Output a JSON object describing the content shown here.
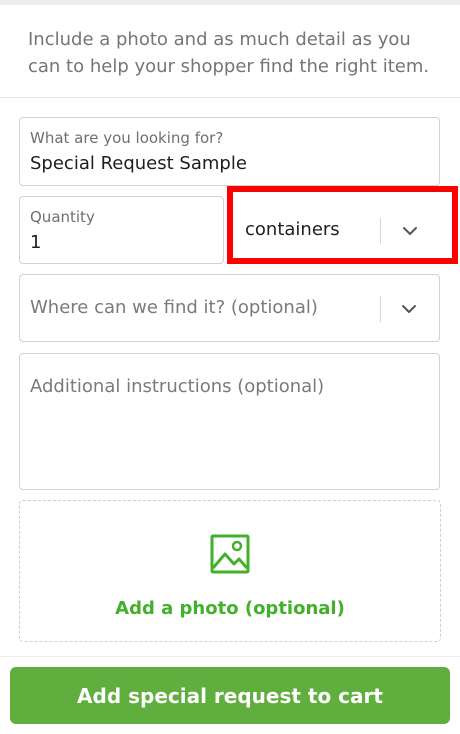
{
  "intro_text": "Include a photo and as much detail as you can to help your shopper find the right item.",
  "item_field": {
    "label": "What are you looking for?",
    "value": "Special Request Sample"
  },
  "quantity_field": {
    "label": "Quantity",
    "value": "1"
  },
  "unit_select": {
    "selected": "containers"
  },
  "location_select": {
    "placeholder": "Where can we find it? (optional)"
  },
  "instructions_field": {
    "placeholder": "Additional instructions (optional)"
  },
  "photo": {
    "label": "Add a photo (optional)",
    "icon": "image-icon"
  },
  "cta": {
    "label": "Add special request to cart"
  },
  "colors": {
    "brand_green": "#43b02a",
    "button_green": "#5fae3e",
    "highlight_red": "#ff0000"
  }
}
